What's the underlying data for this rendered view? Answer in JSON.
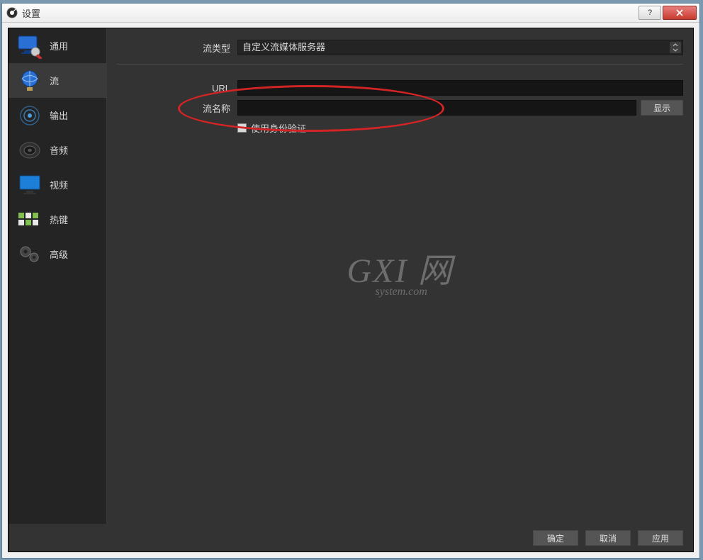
{
  "window": {
    "title": "设置"
  },
  "sidebar": {
    "items": [
      {
        "label": "通用"
      },
      {
        "label": "流"
      },
      {
        "label": "输出"
      },
      {
        "label": "音频"
      },
      {
        "label": "视频"
      },
      {
        "label": "热键"
      },
      {
        "label": "高级"
      }
    ],
    "selected_index": 1
  },
  "form": {
    "stream_type_label": "流类型",
    "stream_type_value": "自定义流媒体服务器",
    "url_label": "URL",
    "url_value": "",
    "stream_name_label": "流名称",
    "stream_name_value": "",
    "show_button": "显示",
    "auth_checkbox_label": "使用身份验证",
    "auth_checked": false
  },
  "buttons": {
    "ok": "确定",
    "cancel": "取消",
    "apply": "应用"
  },
  "watermark": {
    "line1": "GXI 网",
    "line2": "system.com"
  }
}
